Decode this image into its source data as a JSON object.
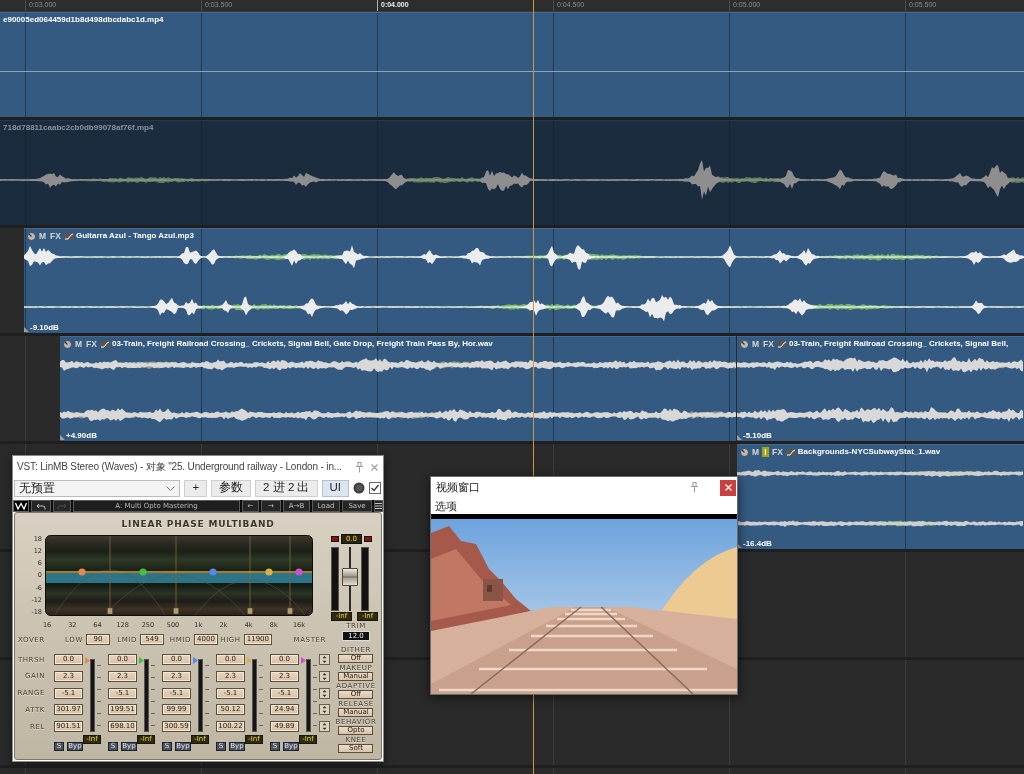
{
  "ruler": [
    {
      "label": "0:03.000",
      "major": false
    },
    {
      "label": "0:03.500",
      "major": false
    },
    {
      "label": "0:04.000",
      "major": true
    },
    {
      "label": "0:04.500",
      "major": false
    },
    {
      "label": "0:05.000",
      "major": false
    },
    {
      "label": "0:05.500",
      "major": false
    }
  ],
  "tracks": [
    {
      "clips": [
        {
          "title": "e90005ed064459d1b8d498dbcdabc1d.mp4",
          "kind": "video",
          "disabled": false
        }
      ]
    },
    {
      "clips": [
        {
          "title": "718d78811caabc2cb0db99078af76f.mp4",
          "kind": "audio-mono",
          "disabled": true
        }
      ]
    },
    {
      "clips": [
        {
          "title": "Guitarra Azul - Tango Azul.mp3",
          "kind": "audio-stereo",
          "disabled": false,
          "badges": [
            {
              "label": "M",
              "kind": "toggle"
            },
            {
              "label": "FX",
              "kind": "toggle"
            }
          ],
          "gain": "-9.10dB"
        }
      ]
    },
    {
      "clips": [
        {
          "title": "03-Train, Freight Railroad Crossing_ Crickets, Signal Bell, Gate Drop, Freight Train Pass By, Hor.wav",
          "kind": "audio-stereo",
          "disabled": false,
          "badges": [
            {
              "label": "M",
              "kind": "toggle"
            },
            {
              "label": "FX",
              "kind": "toggle"
            }
          ],
          "gain": "+4.90dB"
        },
        {
          "title": "03-Train, Freight Railroad Crossing_ Crickets, Signal Bell,",
          "kind": "audio-stereo",
          "disabled": false,
          "badges": [
            {
              "label": "M",
              "kind": "toggle"
            },
            {
              "label": "FX",
              "kind": "toggle"
            }
          ],
          "gain": "-5.10dB"
        }
      ]
    },
    {
      "clips": [
        {
          "title": "Backgrounds-NYCSubwayStat_1.wav",
          "kind": "audio-stereo",
          "disabled": false,
          "badges": [
            {
              "label": "M",
              "kind": "toggle"
            },
            {
              "label": "!",
              "kind": "warning"
            },
            {
              "label": "FX",
              "kind": "toggle"
            }
          ],
          "gain": "-16.4dB"
        }
      ]
    }
  ],
  "plugin_window": {
    "title": "VST: LinMB Stereo (Waves) - 对象 \"25. Underground railway - London - in...",
    "preset": "无预置",
    "buttons": [
      {
        "label": "+",
        "selected": false
      },
      {
        "label": "参数",
        "selected": false
      },
      {
        "label": "2 进 2 出",
        "selected": false
      },
      {
        "label": "UI",
        "selected": true
      }
    ],
    "active": {
      "checked": true
    },
    "toolbar": {
      "history": [
        {
          "kind": "undo",
          "disabled": false
        },
        {
          "kind": "redo",
          "disabled": true
        }
      ],
      "setup": "A: Multi Opto Mastering",
      "buttons": [
        "←",
        "→",
        "A→B",
        "Load",
        "Save"
      ]
    },
    "plugin": {
      "title": "LINEAR PHASE MULTIBAND",
      "db_scale": [
        "18",
        "12",
        "6",
        "0",
        "-6",
        "-12",
        "-18"
      ],
      "freq_scale": [
        "16",
        "32",
        "64",
        "128",
        "250",
        "500",
        "1k",
        "2k",
        "4k",
        "8k",
        "16k"
      ],
      "output": {
        "gain": "0.0",
        "fader": {
          "level": 0.55
        },
        "meters": [
          "-Inf",
          "-Inf"
        ],
        "trim_label": "TRIM",
        "trim": "12.0"
      },
      "xover": {
        "label": "XOVER",
        "points": [
          {
            "label": "LOW",
            "value": "90"
          },
          {
            "label": "LMID",
            "value": "549"
          },
          {
            "label": "HMID",
            "value": "4000"
          },
          {
            "label": "HIGH",
            "value": "11900"
          }
        ],
        "master_label": "MASTER"
      },
      "row_labels": [
        "THRSH",
        "GAIN",
        "RANGE",
        "ATTK",
        "REL"
      ],
      "bands": [
        {
          "color": "#e08a52",
          "values": [
            "0.0",
            "2.3",
            "-5.1",
            "301.97",
            "901.51"
          ],
          "reading": "-Inf",
          "solo": "S",
          "bypass": "Byp"
        },
        {
          "color": "#44c044",
          "values": [
            "0.0",
            "2.3",
            "-5.1",
            "199.51",
            "698.10"
          ],
          "reading": "-Inf",
          "solo": "S",
          "bypass": "Byp"
        },
        {
          "color": "#5588e8",
          "values": [
            "0.0",
            "2.3",
            "-5.1",
            "99.99",
            "300.59"
          ],
          "reading": "-Inf",
          "solo": "S",
          "bypass": "Byp"
        },
        {
          "color": "#d8b048",
          "values": [
            "0.0",
            "2.3",
            "-5.1",
            "50.12",
            "100.22"
          ],
          "reading": "-Inf",
          "solo": "S",
          "bypass": "Byp"
        },
        {
          "color": "#d050d0",
          "values": [
            "0.0",
            "2.3",
            "-5.1",
            "24.94",
            "49.89"
          ],
          "reading": "-Inf",
          "solo": "S",
          "bypass": "Byp"
        }
      ],
      "settings": [
        {
          "label": "DITHER",
          "value": "Off"
        },
        {
          "label": "MAKEUP",
          "value": "Manual"
        },
        {
          "label": "ADAPTIVE",
          "value": "Off"
        },
        {
          "label": "RELEASE",
          "value": "Manual"
        },
        {
          "label": "BEHAVIOR",
          "value": "Opto"
        },
        {
          "label": "KNEE",
          "value": "Soft"
        }
      ]
    }
  },
  "video_window": {
    "title": "视频窗口",
    "menu": [
      "选项"
    ]
  }
}
